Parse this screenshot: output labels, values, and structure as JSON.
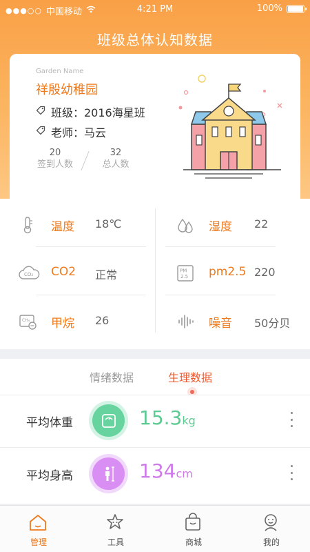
{
  "status_bar": {
    "carrier": "中国移动",
    "time": "4:21 PM",
    "battery": "100%"
  },
  "page_title": "班级总体认知数据",
  "garden": {
    "label": "Garden Name",
    "name": "祥殷幼稚园",
    "class_text": "班级：2016海星班",
    "teacher_text": "老师：马云",
    "signed_in_count": "20",
    "signed_in_label": "签到人数",
    "total_count": "32",
    "total_label": "总人数"
  },
  "environment": [
    {
      "name": "温度",
      "value": "18℃",
      "icon": "thermometer-icon"
    },
    {
      "name": "湿度",
      "value": "22",
      "icon": "humidity-drop-icon"
    },
    {
      "name": "CO2",
      "value": "正常",
      "icon": "co2-cloud-icon"
    },
    {
      "name": "pm2.5",
      "value": "220",
      "icon": "pm25-icon"
    },
    {
      "name": "甲烷",
      "value": "26",
      "icon": "methane-icon"
    },
    {
      "name": "噪音",
      "value": "50分贝",
      "icon": "sound-wave-icon"
    }
  ],
  "data_tabs": {
    "emotion": "情绪数据",
    "physiology": "生理数据",
    "active": "physiology"
  },
  "metrics": [
    {
      "label": "平均体重",
      "value": "15.3",
      "unit": "kg",
      "icon": "scale-icon",
      "color": "#5cca92"
    },
    {
      "label": "平均身高",
      "value": "134",
      "unit": "cm",
      "icon": "height-ruler-icon",
      "color": "#cf7ae9"
    }
  ],
  "tabbar": [
    {
      "label": "管理",
      "icon": "home-icon",
      "active": true
    },
    {
      "label": "工具",
      "icon": "tools-icon",
      "active": false
    },
    {
      "label": "商城",
      "icon": "shopping-bag-icon",
      "active": false
    },
    {
      "label": "我的",
      "icon": "profile-icon",
      "active": false
    }
  ],
  "colors": {
    "accent": "#ee7a1d",
    "header_gradient_top": "#f9a047",
    "header_gradient_bottom": "#fdc986",
    "active_tab": "#ee5a2f"
  }
}
